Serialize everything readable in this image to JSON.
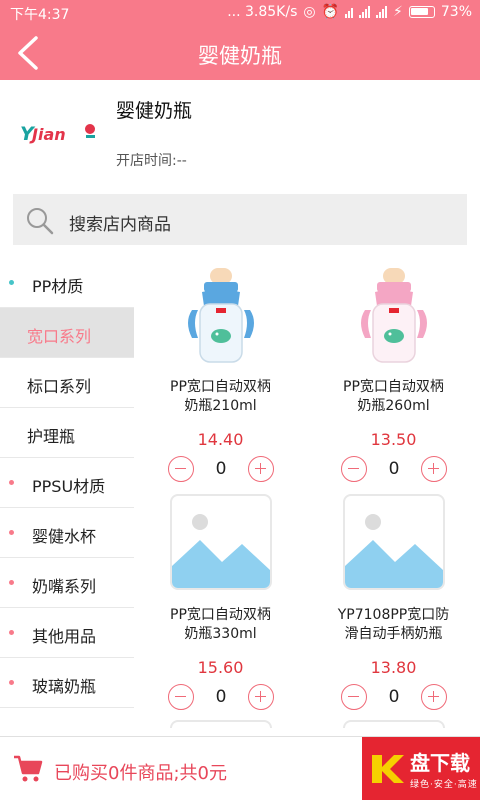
{
  "status_bar": {
    "time": "下午4:37",
    "speed": "... 3.85K/s",
    "battery": "73%"
  },
  "header": {
    "title": "婴健奶瓶"
  },
  "store": {
    "name": "婴健奶瓶",
    "logo_text": "Jian",
    "hours_label": "开店时间:",
    "hours_value": "--"
  },
  "search": {
    "placeholder": "搜索店内商品"
  },
  "sidebar": {
    "items": [
      {
        "label": "PP材质",
        "type": "category"
      },
      {
        "label": "宽口系列",
        "type": "sub",
        "active": true
      },
      {
        "label": "标口系列",
        "type": "sub"
      },
      {
        "label": "护理瓶",
        "type": "sub"
      },
      {
        "label": "PPSU材质",
        "type": "category"
      },
      {
        "label": "婴健水杯",
        "type": "category"
      },
      {
        "label": "奶嘴系列",
        "type": "category"
      },
      {
        "label": "其他用品",
        "type": "category"
      },
      {
        "label": "玻璃奶瓶",
        "type": "category"
      }
    ]
  },
  "products": [
    {
      "name_line1": "PP宽口自动双柄",
      "name_line2": "奶瓶210ml",
      "price": "14.40",
      "qty": "0",
      "image": "blue-bottle"
    },
    {
      "name_line1": "PP宽口自动双柄",
      "name_line2": "奶瓶260ml",
      "price": "13.50",
      "qty": "0",
      "image": "pink-bottle"
    },
    {
      "name_line1": "PP宽口自动双柄",
      "name_line2": "奶瓶330ml",
      "price": "15.60",
      "qty": "0",
      "image": "placeholder-image"
    },
    {
      "name_line1": "YP7108PP宽口防",
      "name_line2": "滑自动手柄奶瓶",
      "price": "13.80",
      "qty": "0",
      "image": "placeholder-image"
    }
  ],
  "cart": {
    "summary": "已购买0件商品;共0元"
  },
  "watermark": {
    "main": "盘下载",
    "sub": "绿色·安全·高速"
  },
  "colors": {
    "accent": "#f87a8a",
    "price": "#e0363e",
    "active_bg": "#e2e2e2"
  }
}
